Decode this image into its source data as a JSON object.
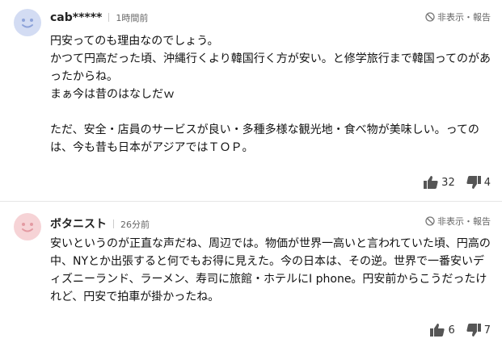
{
  "comments": [
    {
      "username": "cab*****",
      "time": "1時間前",
      "report_label": "非表示・報告",
      "body": "円安ってのも理由なのでしょう。\nかつて円高だった頃、沖縄行くより韓国行く方が安い。と修学旅行まで韓国ってのがあったからね。\nまぁ今は昔のはなしだｗ\n\nただ、安全・店員のサービスが良い・多種多様な観光地・食べ物が美味しい。ってのは、今も昔も日本がアジアではＴＯＰ。",
      "likes": "32",
      "dislikes": "4",
      "avatar_color": "#d3dcf3"
    },
    {
      "username": "ボタニスト",
      "time": "26分前",
      "report_label": "非表示・報告",
      "body": "安いというのが正直な声だね、周辺では。物価が世界一高いと言われていた頃、円高の中、NYとか出張すると何でもお得に見えた。今の日本は、その逆。世界で一番安いディズニーランド、ラーメン、寿司に旅館・ホテルにI phone。円安前からこうだったけれど、円安で拍車が掛かったね。",
      "likes": "6",
      "dislikes": "7",
      "avatar_color": "#f6d3d6"
    }
  ],
  "icons": {
    "avatar": "smiley-face-icon",
    "report": "no-entry-icon",
    "like": "thumbs-up-icon",
    "dislike": "thumbs-down-icon"
  }
}
